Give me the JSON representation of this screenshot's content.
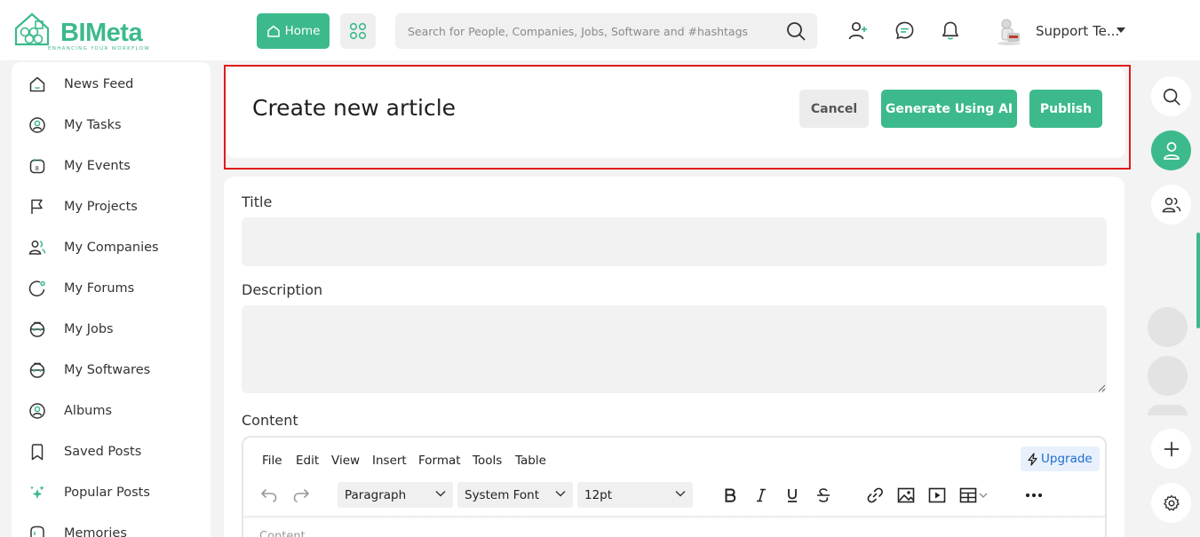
{
  "brand": {
    "name": "BIMeta",
    "tagline": "ENHANCING YOUR WORKFLOW",
    "accent": "#3cba8b"
  },
  "topbar": {
    "home_label": "Home",
    "search_placeholder": "Search for People, Companies, Jobs, Software and #hashtags",
    "user_name": "Support Te..."
  },
  "sidebar": {
    "items": [
      {
        "label": "News Feed",
        "icon": "home-icon"
      },
      {
        "label": "My Tasks",
        "icon": "tasks-icon"
      },
      {
        "label": "My Events",
        "icon": "calendar-icon"
      },
      {
        "label": "My Projects",
        "icon": "flag-icon"
      },
      {
        "label": "My Companies",
        "icon": "users-icon"
      },
      {
        "label": "My Forums",
        "icon": "forum-icon"
      },
      {
        "label": "My Jobs",
        "icon": "briefcase-icon"
      },
      {
        "label": "My Softwares",
        "icon": "software-icon"
      },
      {
        "label": "Albums",
        "icon": "album-icon"
      },
      {
        "label": "Saved Posts",
        "icon": "bookmark-icon"
      },
      {
        "label": "Popular Posts",
        "icon": "sparkle-icon"
      },
      {
        "label": "Memories",
        "icon": "memories-icon"
      }
    ]
  },
  "header": {
    "title": "Create new article",
    "cancel_label": "Cancel",
    "ai_label": "Generate Using AI",
    "publish_label": "Publish"
  },
  "form": {
    "title_label": "Title",
    "title_value": "",
    "description_label": "Description",
    "description_value": "",
    "content_label": "Content"
  },
  "editor": {
    "menu": [
      "File",
      "Edit",
      "View",
      "Insert",
      "Format",
      "Tools",
      "Table"
    ],
    "upgrade_label": "Upgrade",
    "block_format": "Paragraph",
    "font_family": "System Font",
    "font_size": "12pt",
    "body_placeholder": "Content..."
  }
}
